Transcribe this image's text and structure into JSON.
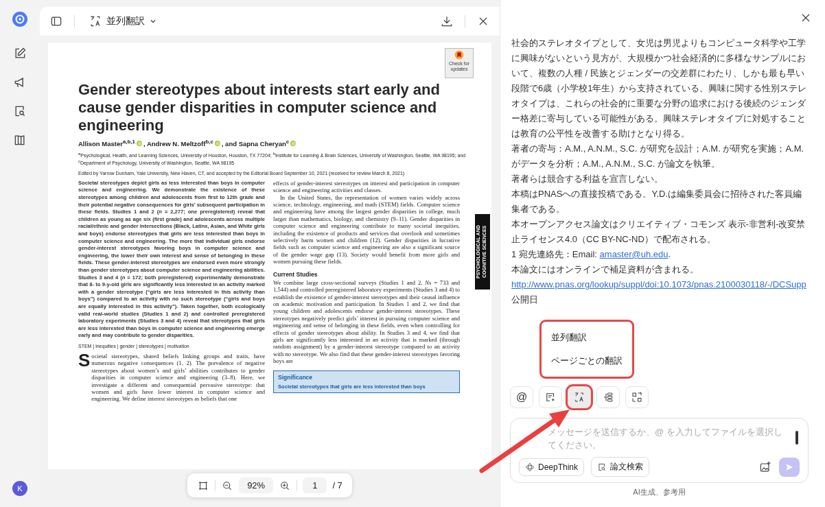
{
  "sidebar": {
    "avatar": "K"
  },
  "viewer": {
    "mode_label": "並列翻訳",
    "zoom": "92%",
    "page": "1",
    "page_total": "/ 7"
  },
  "paper": {
    "badge": "Check for updates",
    "side_tab": "PSYCHOLOGICAL AND COGNITIVE SCIENCES",
    "title": "Gender stereotypes about interests start early and cause gender disparities in computer science and engineering",
    "authors": [
      "Allison Master$^{a,b,1}$",
      ", Andrew N. Meltzoff$^{b,c}$",
      ", and Sapna Cheryan$^{c}$"
    ],
    "affiliations": "$^{a}$Psychological, Health, and Learning Sciences, University of Houston, Houston, TX 77204; $^{b}$Institute for Learning & Brain Sciences, University of Washington, Seattle, WA 98195; and $^{c}$Department of Psychology, University of Washington, Seattle, WA 98195",
    "editor": "Edited by Yarrow Dunham, Yale University, New Haven, CT, and accepted by the Editorial Board September 10, 2021 (received for review March 8, 2021)",
    "abstract": "Societal stereotypes depict girls as less interested than boys in computer science and engineering. We demonstrate the existence of these stereotypes among children and adolescents from first to 12th grade and their potential negative consequences for girls’ subsequent participation in these fields. Studies 1 and 2 (*n* = 2,277; one preregistered) reveal that children as young as age six (first grade) and adolescents across multiple racial/ethnic and gender intersections (Black, Latinx, Asian, and White girls and boys) endorse stereotypes that girls are less interested than boys in computer science and engineering. The more that individual girls endorse gender-interest stereotypes favoring boys in computer science and engineering, the lower their own interest and sense of belonging in these fields. These gender-interest stereotypes are endorsed even more strongly than gender stereotypes about computer science and engineering abilities. Studies 3 and 4 (*n* = 172; both preregistered) experimentally demonstrate that 8- to 9-y-old girls are significantly less interested in an activity marked with a gender stereotype (“girls are less interested in this activity than boys”) compared to an activity with no such stereotype (“girls and boys are equally interested in this activity”). Taken together, both ecologically valid real-world studies (Studies 1 and 2) and controlled preregistered laboratory experiments (Studies 3 and 4) reveal that stereotypes that girls are less interested than boys in computer science and engineering emerge early and may contribute to gender disparities.",
    "keywords": "STEM | inequities | gender | stereotypes | motivation",
    "drop_cap": "S",
    "body_left": "ocietal stereotypes, shared beliefs linking groups and traits, have numerous negative consequences (1, 2). The prevalence of negative stereotypes about women’s and girls’ abilities contributes to gender disparities in computer science and engineering (3–8). Here, we investigate a different and consequential pervasive stereotype: that women and girls have lower interest in computer science and engineering. We define interest stereotypes as beliefs that one",
    "body_right": [
      "effects of gender-interest stereotypes on interest and participation in computer science and engineering activities and classes.",
      "In the United States, the representation of women varies widely across science, technology, engineering, and math (STEM) fields. Computer science and engineering have among the largest gender disparities in college, much larger than mathematics, biology, and chemistry (9–11). Gender disparities in computer science and engineering contribute to many societal inequities, including the existence of products and services that overlook and sometimes selectively harm women and children (12). Gender disparities in lucrative fields such as computer science and engineering are also a significant source of the gender wage gap (13). Society would benefit from more girls and women pursuing these fields."
    ],
    "heading": "Current Studies",
    "current": "We combine large cross-sectional surveys (Studies 1 and 2, *Ns* = 733 and 1,544) and controlled preregistered laboratory experiments (Studies 3 and 4) to establish the existence of gender-interest stereotypes and their causal influence on academic motivation and participation. In Studies 1 and 2, we find that young children and adolescents endorse gender-interest stereotypes. These stereotypes negatively predict girls’ interest in pursuing computer science and engineering and sense of belonging in these fields, even when controlling for effects of gender stereotypes about ability. In Studies 3 and 4, we find that girls are significantly less interested in an activity that is marked (through random assignment) by a gender-interest stereotype compared to an activity with no stereotype. We also find that these gender-interest stereotypes favoring boys are",
    "significance": {
      "heading": "Significance",
      "text": "Societal stereotypes that girls are less interested than boys"
    }
  },
  "assistant": {
    "paragraphs": [
      {
        "kind": "text",
        "text": "社会的ステレオタイプとして、女児は男児よりもコンピュータ科学や工学に興味がないという見方が、大規模かつ社会経済的に多様なサンプルにおいて、複数の人種 / 民族とジェンダーの交差群にわたり、しかも最も早い段階で6歳（小学校1年生）から支持されている。興味に関する性別ステレオタイプは、これらの社会的に重要な分野の追求における後続のジェンダー格差に寄与している可能性がある。興味ステレオタイプに対処することは教育の公平性を改善する助けとなり得る。"
      },
      {
        "kind": "text",
        "text": "著者の寄与：A.M., A.N.M., S.C. が研究を設計；A.M. が研究を実施；A.M. がデータを分析；A.M., A.N.M., S.C. が論文を執筆。"
      },
      {
        "kind": "text",
        "text": "著者らは競合する利益を宣言しない。"
      },
      {
        "kind": "text",
        "text": "本稿はPNASへの直接投稿である。Y.D.は編集委員会に招待された客員編集者である。"
      },
      {
        "kind": "text",
        "text": "本オープンアクセス論文はクリエイティブ・コモンズ 表示-非営利-改変禁止ライセンス4.0（CC BY-NC-ND）で配布される。"
      },
      {
        "kind": "email",
        "text": "1 宛先連絡先：Email: ",
        "link": "amaster@uh.edu",
        "after": "."
      },
      {
        "kind": "text",
        "text": "本論文にはオンラインで補足資料が含まれる。"
      },
      {
        "kind": "link",
        "text": "http://www.pnas.org/lookup/suppl/doi:10.1073/pnas.2100030118/-/DCSupp"
      },
      {
        "kind": "text",
        "text": "公開日"
      }
    ],
    "menu": {
      "highlighted": true,
      "items": [
        "並列翻訳",
        "ページごとの翻訳"
      ]
    },
    "tools": [
      {
        "kind": "mention",
        "label": "@",
        "selected": false,
        "highlighted": false
      },
      {
        "kind": "note",
        "selected": false,
        "highlighted": false
      },
      {
        "kind": "translate",
        "selected": true,
        "highlighted": true
      },
      {
        "kind": "outline",
        "selected": false,
        "highlighted": false
      },
      {
        "kind": "scan",
        "selected": false,
        "highlighted": false
      }
    ],
    "input": {
      "placeholder": "メッセージを送信するか、@ を入力してファイルを選択してください。"
    },
    "deepthink": "DeepThink",
    "search": "論文検索",
    "footer": "AI生成、参考用"
  }
}
